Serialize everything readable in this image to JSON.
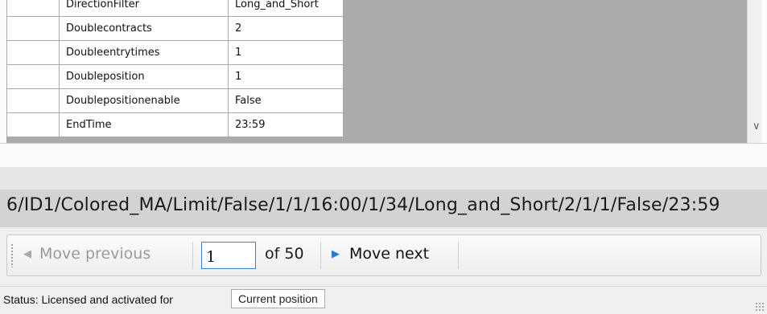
{
  "grid": {
    "rows": [
      {
        "name": "DirectionFilter",
        "value": "Long_and_Short"
      },
      {
        "name": "Doublecontracts",
        "value": "2"
      },
      {
        "name": "Doubleentrytimes",
        "value": "1"
      },
      {
        "name": "Doubleposition",
        "value": "1"
      },
      {
        "name": "Doublepositionenable",
        "value": "False"
      },
      {
        "name": "EndTime",
        "value": "23:59"
      }
    ]
  },
  "combo": {
    "text": "6/ID1/Colored_MA/Limit/False/1/1/16:00/1/34/Long_and_Short/2/1/1/False/23:59"
  },
  "navigator": {
    "prev_label": "Move previous",
    "position_value": "1",
    "of_label": "of 50",
    "next_label": "Move next"
  },
  "status": {
    "label": "Status:  Licensed and activated for",
    "position_box": "Current position"
  },
  "icons": {
    "prev": "triangle-left-icon",
    "next": "triangle-right-icon",
    "scroll_down": "chevron-down-icon"
  },
  "colors": {
    "accent": "#2b78d6",
    "grid_background": "#ababab"
  }
}
